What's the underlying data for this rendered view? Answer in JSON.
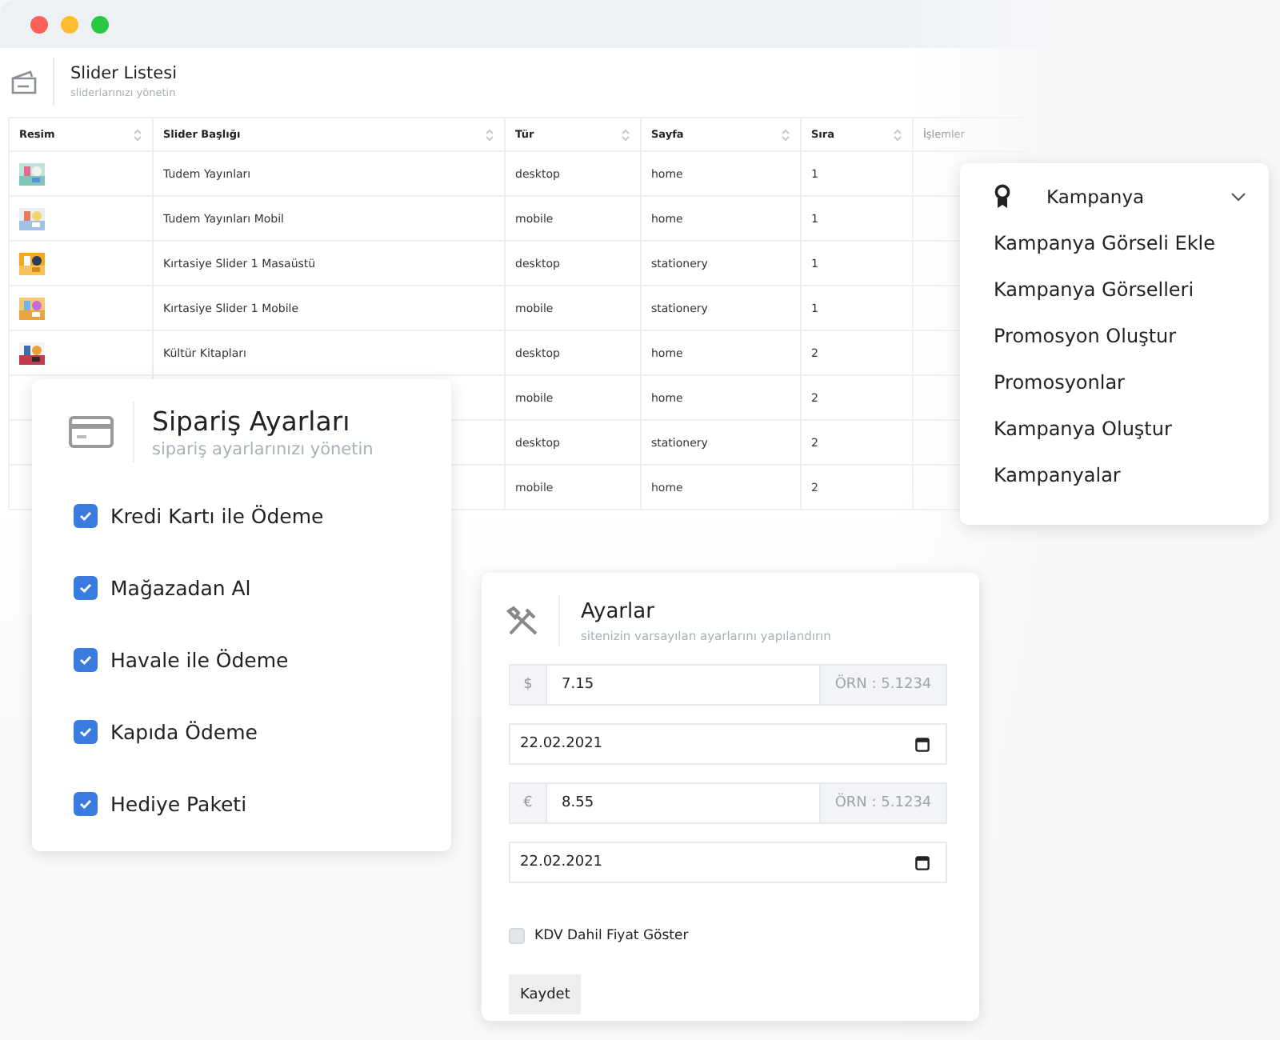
{
  "page_header": {
    "title": "Slider Listesi",
    "subtitle": "sliderlarınızı yönetin"
  },
  "table": {
    "columns": [
      "Resim",
      "Slider Başlığı",
      "Tür",
      "Sayfa",
      "Sıra",
      "İşlemler"
    ],
    "rows": [
      {
        "title": "Tudem Yayınları",
        "type": "desktop",
        "page": "home",
        "order": "1"
      },
      {
        "title": "Tudem Yayınları Mobil",
        "type": "mobile",
        "page": "home",
        "order": "1"
      },
      {
        "title": "Kırtasiye Slider 1 Masaüstü",
        "type": "desktop",
        "page": "stationery",
        "order": "1"
      },
      {
        "title": "Kırtasiye Slider 1 Mobile",
        "type": "mobile",
        "page": "stationery",
        "order": "1"
      },
      {
        "title": "Kültür Kitapları",
        "type": "desktop",
        "page": "home",
        "order": "2"
      },
      {
        "type": "mobile",
        "page": "home",
        "order": "2"
      },
      {
        "type": "desktop",
        "page": "stationery",
        "order": "2"
      },
      {
        "type": "mobile",
        "page": "home",
        "order": "2"
      }
    ]
  },
  "order_settings": {
    "title": "Sipariş Ayarları",
    "subtitle": "sipariş ayarlarınızı yönetin",
    "options": [
      {
        "label": "Kredi Kartı ile Ödeme",
        "checked": true
      },
      {
        "label": "Mağazadan Al",
        "checked": true
      },
      {
        "label": "Havale ile Ödeme",
        "checked": true
      },
      {
        "label": "Kapıda Ödeme",
        "checked": true
      },
      {
        "label": "Hediye Paketi",
        "checked": true
      }
    ]
  },
  "campaign_menu": {
    "title": "Kampanya",
    "expanded": true,
    "items": [
      "Kampanya Görseli Ekle",
      "Kampanya Görselleri",
      "Promosyon Oluştur",
      "Promosyonlar",
      "Kampanya Oluştur",
      "Kampanyalar"
    ]
  },
  "settings": {
    "title": "Ayarlar",
    "subtitle": "sitenizin varsayılan ayarlarını yapılandırın",
    "fields": [
      {
        "kind": "currency",
        "prefix": "$",
        "value": "7.15",
        "suffix": "ÖRN : 5.1234"
      },
      {
        "kind": "date",
        "value": "22.02.2021"
      },
      {
        "kind": "currency",
        "prefix": "€",
        "value": "8.55",
        "suffix": "ÖRN : 5.1234"
      },
      {
        "kind": "date",
        "value": "22.02.2021"
      }
    ],
    "vat_checkbox": {
      "label": "KDV Dahil Fiyat Göster",
      "checked": false
    },
    "save_button": "Kaydet"
  }
}
